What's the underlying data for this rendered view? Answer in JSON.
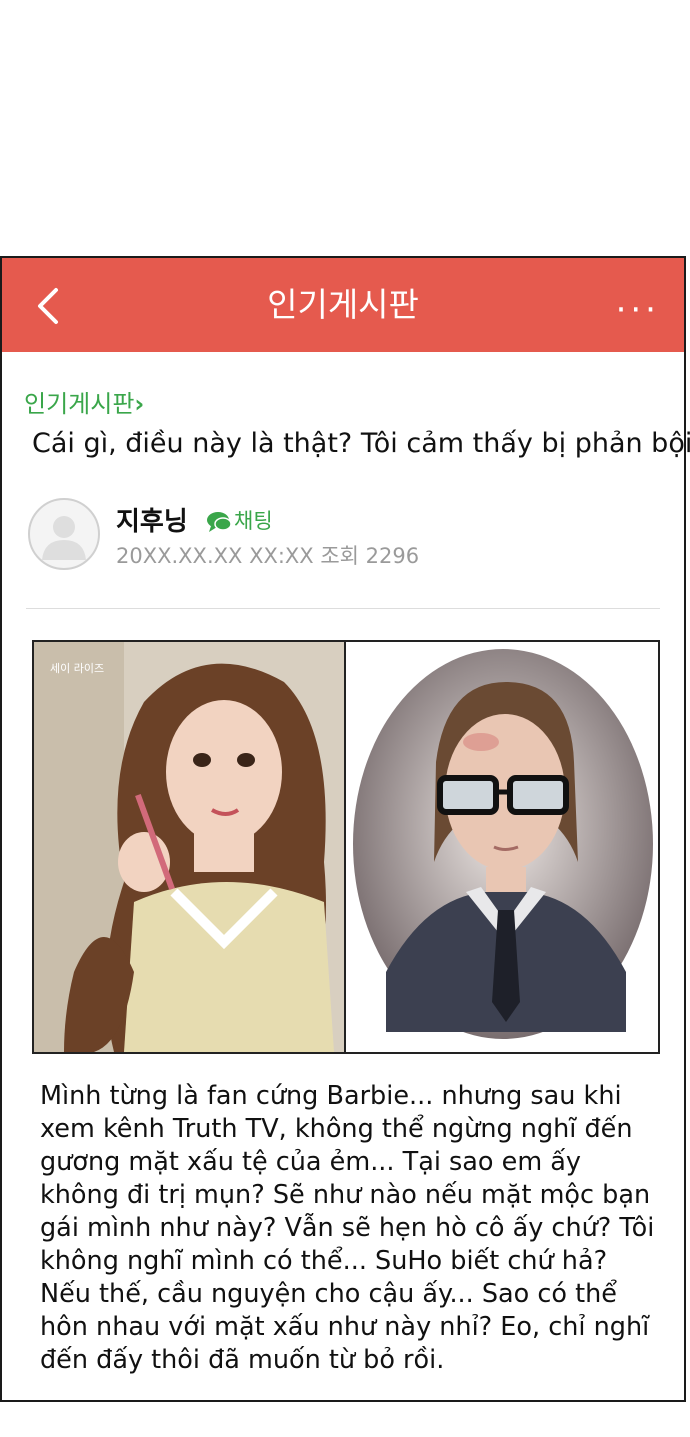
{
  "header": {
    "title": "인기게시판",
    "back_icon": "chevron-left-icon",
    "more_label": "···"
  },
  "breadcrumb": {
    "label": "인기게시판",
    "chevron": "›"
  },
  "post": {
    "title": "Cái gì, điều này là thật? Tôi cảm thấy bị phản bội",
    "author": "지후닝",
    "chat_label": "채팅",
    "meta": "20XX.XX.XX  XX:XX  조회 2296",
    "watermark": "세이 라이즈",
    "body": "Mình từng là fan cứng Barbie... nhưng sau khi xem kênh Truth TV, không thể ngừng nghĩ đến gương mặt xấu tệ của ẻm... Tại sao em ấy không đi trị mụn? Sẽ như nào nếu mặt mộc bạn gái mình như này? Vẫn sẽ hẹn hò cô ấy chứ? Tôi không nghĩ mình có thể... SuHo biết chứ hả? Nếu thế, cầu nguyện cho cậu ấy... Sao có thể hôn nhau với mặt xấu như này nhỉ? Eo, chỉ nghĩ đến đấy thôi đã muốn từ bỏ rồi."
  },
  "colors": {
    "header_bg": "#e55a4e",
    "accent_green": "#3aa64a",
    "meta_gray": "#9a9a9a"
  }
}
